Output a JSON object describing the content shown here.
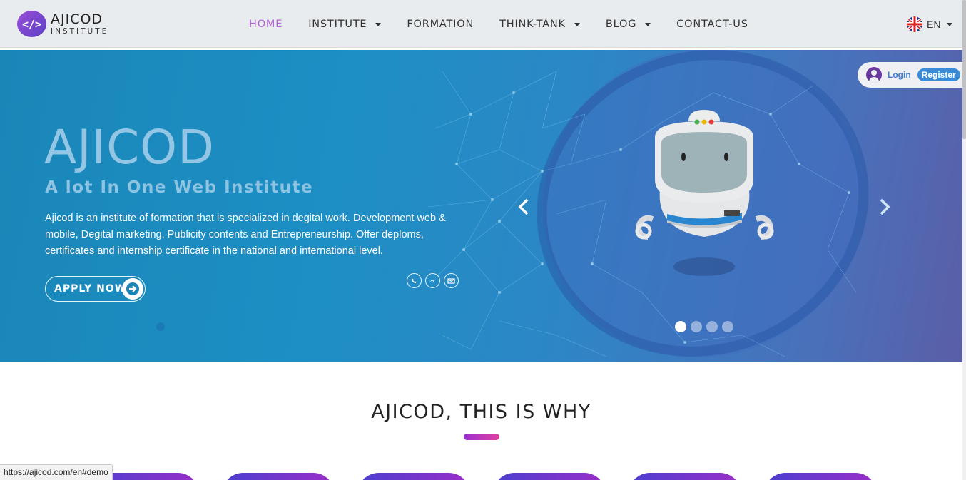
{
  "logo": {
    "badge": "</>",
    "name": "AJICOD",
    "sub": "INSTITUTE"
  },
  "nav": {
    "items": [
      {
        "label": "HOME",
        "active": true,
        "dropdown": false
      },
      {
        "label": "INSTITUTE",
        "active": false,
        "dropdown": true
      },
      {
        "label": "FORMATION",
        "active": false,
        "dropdown": false
      },
      {
        "label": "THINK-TANK",
        "active": false,
        "dropdown": true
      },
      {
        "label": "BLOG",
        "active": false,
        "dropdown": true
      },
      {
        "label": "CONTACT-US",
        "active": false,
        "dropdown": false
      }
    ],
    "language": "EN"
  },
  "hero": {
    "title": "AJICOD",
    "subtitle": "A lot In One Web Institute",
    "description": "Ajicod is an institute of formation that is specialized in degital work. Development web & mobile, Degital marketing, Publicity contents and Entrepreneurship. Offer deploms, certificates and internship certificate in the national and international level.",
    "apply_label": "APPLY NOW",
    "contact_icons": [
      "whatsapp-icon",
      "messenger-icon",
      "mail-icon"
    ],
    "slides": 4,
    "active_slide": 1
  },
  "auth": {
    "login": "Login",
    "register": "Register"
  },
  "section": {
    "title": "AJICOD, THIS IS WHY"
  },
  "status_bar": {
    "url": "https://ajicod.com/en#demo"
  },
  "colors": {
    "accent": "#b562d8",
    "hero_start": "#1a86b8",
    "hero_end": "#5a5ea7",
    "underline": "#9b2fd0"
  }
}
